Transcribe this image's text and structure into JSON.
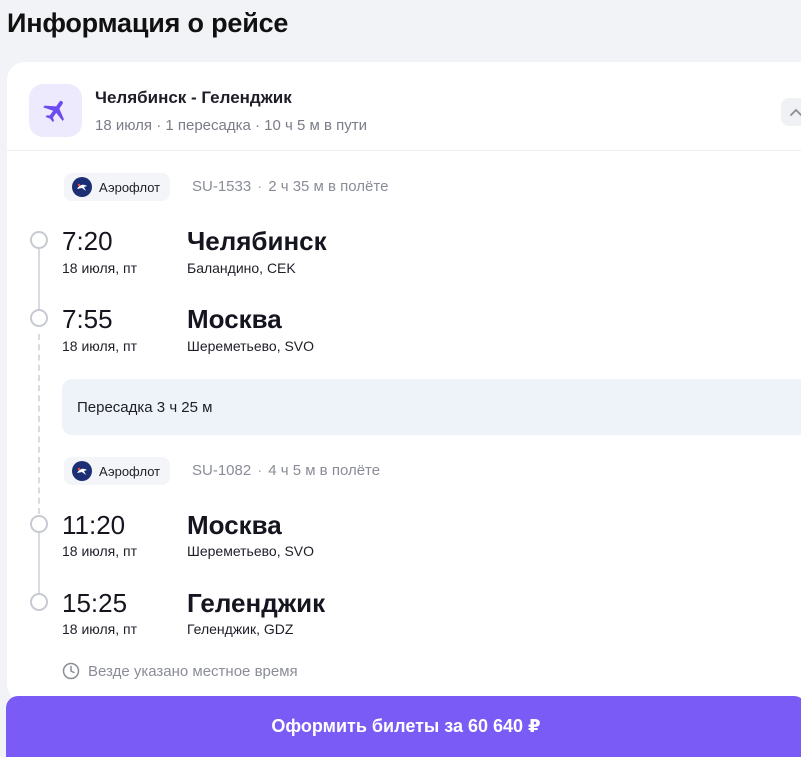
{
  "page_title": "Информация о рейсе",
  "route": {
    "title": "Челябинск - Геленджик",
    "subtitle": "18 июля · 1 пересадка · 10 ч 5 м в пути"
  },
  "segments": [
    {
      "airline": "Аэрофлот",
      "flight_number": "SU-1533",
      "separator": "·",
      "duration": "2 ч 35 м в полёте",
      "departure": {
        "time": "7:20",
        "date": "18 июля, пт",
        "city": "Челябинск",
        "airport": "Баландино, CEK"
      },
      "arrival": {
        "time": "7:55",
        "date": "18 июля, пт",
        "city": "Москва",
        "airport": "Шереметьево, SVO"
      }
    },
    {
      "airline": "Аэрофлот",
      "flight_number": "SU-1082",
      "separator": "·",
      "duration": "4 ч 5 м в полёте",
      "departure": {
        "time": "11:20",
        "date": "18 июля, пт",
        "city": "Москва",
        "airport": "Шереметьево, SVO"
      },
      "arrival": {
        "time": "15:25",
        "date": "18 июля, пт",
        "city": "Геленджик",
        "airport": "Геленджик, GDZ"
      }
    }
  ],
  "transfer": {
    "label": "Пересадка 3 ч 25 м"
  },
  "local_time_note": "Везде указано местное время",
  "buy_button": {
    "label": "Оформить билеты за 60 640 ₽"
  },
  "icons": {
    "plane": "airplane-icon",
    "collapse": "chevron-up-icon",
    "airline_logo": "aeroflot-logo",
    "clock": "clock-icon"
  },
  "colors": {
    "accent": "#7a5bf5",
    "plane_badge_bg": "#eeeafd",
    "transfer_bg": "#eef2f9",
    "muted_text": "#8a8d97"
  }
}
